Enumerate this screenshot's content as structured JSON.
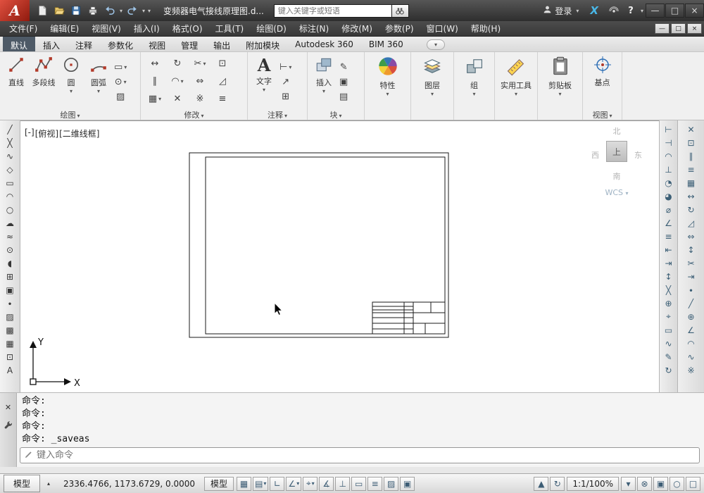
{
  "colors": {
    "titlebar": "#3a3a3a",
    "logo_red": "#a82114",
    "active_tab": "#4e5a67",
    "exchange_blue": "#49b8e8"
  },
  "titlebar": {
    "logo_letter": "A",
    "doc_title": "变频器电气接线原理图.d...",
    "search_placeholder": "键入关键字或短语",
    "login": "登录",
    "help": "?",
    "min": "—",
    "max": "□",
    "close": "×"
  },
  "menus": {
    "items": [
      {
        "name": "menu-file",
        "label": "文件(F)"
      },
      {
        "name": "menu-edit",
        "label": "编辑(E)"
      },
      {
        "name": "menu-view",
        "label": "视图(V)"
      },
      {
        "name": "menu-insert",
        "label": "插入(I)"
      },
      {
        "name": "menu-format",
        "label": "格式(O)"
      },
      {
        "name": "menu-tools",
        "label": "工具(T)"
      },
      {
        "name": "menu-draw",
        "label": "绘图(D)"
      },
      {
        "name": "menu-dimension",
        "label": "标注(N)"
      },
      {
        "name": "menu-modify",
        "label": "修改(M)"
      },
      {
        "name": "menu-parametric",
        "label": "参数(P)"
      },
      {
        "name": "menu-window",
        "label": "窗口(W)"
      },
      {
        "name": "menu-help",
        "label": "帮助(H)"
      }
    ]
  },
  "docwin": {
    "min": "—",
    "restore": "□",
    "close": "×"
  },
  "ribbon_tabs": {
    "items": [
      {
        "name": "tab-home",
        "label": "默认",
        "active": true
      },
      {
        "name": "tab-insert",
        "label": "插入"
      },
      {
        "name": "tab-annotate",
        "label": "注释"
      },
      {
        "name": "tab-parametric",
        "label": "参数化"
      },
      {
        "name": "tab-view",
        "label": "视图"
      },
      {
        "name": "tab-manage",
        "label": "管理"
      },
      {
        "name": "tab-output",
        "label": "输出"
      },
      {
        "name": "tab-addins",
        "label": "附加模块"
      },
      {
        "name": "tab-a360",
        "label": "Autodesk 360"
      },
      {
        "name": "tab-bim360",
        "label": "BIM 360"
      }
    ]
  },
  "panels": {
    "draw": {
      "title": "绘图",
      "line": "直线",
      "polyline": "多段线",
      "circle": "圆",
      "arc": "圆弧",
      "small": [
        {
          "name": "rectangle-icon",
          "glyph": "▭",
          "caret": true
        },
        {
          "name": "ellipse-icon",
          "glyph": "⊙",
          "caret": true
        },
        {
          "name": "hatch-icon",
          "glyph": "▨"
        }
      ]
    },
    "modify": {
      "title": "修改",
      "icons": [
        {
          "name": "move-icon",
          "glyph": "↔"
        },
        {
          "name": "rotate-icon",
          "glyph": "↻"
        },
        {
          "name": "trim-icon",
          "glyph": "✂",
          "caret": true
        },
        {
          "name": "copy-icon",
          "glyph": "⊡"
        },
        {
          "name": "mirror-icon",
          "glyph": "∥"
        },
        {
          "name": "fillet-icon",
          "glyph": "◠",
          "caret": true
        },
        {
          "name": "stretch-icon",
          "glyph": "⇔"
        },
        {
          "name": "scale-icon",
          "glyph": "◿"
        },
        {
          "name": "array-icon",
          "glyph": "▦",
          "caret": true
        },
        {
          "name": "erase-icon",
          "glyph": "✕"
        },
        {
          "name": "explode-icon",
          "glyph": "※"
        },
        {
          "name": "offset-icon",
          "glyph": "≡"
        }
      ]
    },
    "annotate": {
      "title": "注释",
      "text": "文字",
      "icon": "A",
      "small": [
        {
          "name": "linear-dimension-icon",
          "glyph": "⊢",
          "caret": true
        },
        {
          "name": "leader-icon",
          "glyph": "↗"
        },
        {
          "name": "table-icon",
          "glyph": "⊞"
        }
      ]
    },
    "block": {
      "title": "块",
      "insert": "插入",
      "small": [
        {
          "name": "edit-block-icon",
          "glyph": "✎"
        },
        {
          "name": "create-block-icon",
          "glyph": "▣"
        },
        {
          "name": "block-attributes-icon",
          "glyph": "▤"
        }
      ]
    },
    "properties": {
      "title": "特性"
    },
    "layers": {
      "title": "图层"
    },
    "groups": {
      "title": "组"
    },
    "utilities": {
      "title": "实用工具"
    },
    "clipboard": {
      "title": "剪贴板"
    },
    "view": {
      "title": "视图",
      "basepoint": "基点"
    }
  },
  "canvas": {
    "viewport_menu": "[-]",
    "viewport_view": "[俯视]",
    "viewport_visual": "[二维线框]",
    "viewcube": {
      "n": "北",
      "s": "南",
      "w": "西",
      "e": "东",
      "top": "上",
      "wcs": "WCS"
    },
    "ucs_x": "X",
    "ucs_y": "Y"
  },
  "command": {
    "history": [
      "命令:",
      "命令:",
      "命令:",
      "命令: _saveas"
    ],
    "placeholder": "键入命令"
  },
  "statusbar": {
    "model_tab": "模型",
    "coords": "2336.4766, 1173.6729, 0.0000",
    "model_button": "模型",
    "scale": "1:1/100%",
    "icons_left": [
      {
        "name": "grid-display-icon",
        "glyph": "▦"
      },
      {
        "name": "snap-mode-icon",
        "glyph": "▤",
        "caret": true
      },
      {
        "name": "ortho-mode-icon",
        "glyph": "∟"
      },
      {
        "name": "polar-tracking-icon",
        "glyph": "∠",
        "caret": true
      },
      {
        "name": "object-snap-icon",
        "glyph": "⌖",
        "caret": true
      },
      {
        "name": "object-snap-tracking-icon",
        "glyph": "∡"
      },
      {
        "name": "dynamic-ucs-icon",
        "glyph": "⊥"
      },
      {
        "name": "dynamic-input-icon",
        "glyph": "▭"
      },
      {
        "name": "lineweight-icon",
        "glyph": "≡"
      },
      {
        "name": "transparency-icon",
        "glyph": "▨"
      },
      {
        "name": "quick-properties-icon",
        "glyph": "▣"
      }
    ],
    "icons_right_a": [
      {
        "name": "annotation-visibility-icon",
        "glyph": "▲"
      },
      {
        "name": "annotation-autoscale-icon",
        "glyph": "↻"
      }
    ],
    "icons_right_b": [
      {
        "name": "annotation-scale-caret-icon",
        "glyph": "▾"
      },
      {
        "name": "workspace-switching-icon",
        "glyph": "⊗"
      },
      {
        "name": "display-lock-icon",
        "glyph": "▣"
      },
      {
        "name": "isolate-objects-icon",
        "glyph": "○"
      },
      {
        "name": "clean-screen-icon",
        "glyph": "□"
      }
    ]
  },
  "toolbars": {
    "left": [
      {
        "name": "line-icon",
        "glyph": "╱"
      },
      {
        "name": "construction-line-icon",
        "glyph": "╳"
      },
      {
        "name": "polyline-icon",
        "glyph": "∿"
      },
      {
        "name": "polygon-icon",
        "glyph": "◇"
      },
      {
        "name": "rectangle-icon",
        "glyph": "▭"
      },
      {
        "name": "arc-icon",
        "glyph": "◠"
      },
      {
        "name": "circle-icon",
        "glyph": "○"
      },
      {
        "name": "revision-cloud-icon",
        "glyph": "☁"
      },
      {
        "name": "spline-icon",
        "glyph": "≈"
      },
      {
        "name": "ellipse-icon",
        "glyph": "⊙"
      },
      {
        "name": "ellipse-arc-icon",
        "glyph": "◖"
      },
      {
        "name": "insert-block-icon",
        "glyph": "⊞"
      },
      {
        "name": "create-block-icon",
        "glyph": "▣"
      },
      {
        "name": "point-icon",
        "glyph": "∙"
      },
      {
        "name": "hatch-icon",
        "glyph": "▨"
      },
      {
        "name": "gradient-icon",
        "glyph": "▩"
      },
      {
        "name": "region-icon",
        "glyph": "▦"
      },
      {
        "name": "table-icon",
        "glyph": "⊡"
      },
      {
        "name": "mtext-icon",
        "glyph": "A"
      }
    ],
    "right_dim": [
      {
        "name": "dim-linear-icon",
        "glyph": "⊢"
      },
      {
        "name": "dim-aligned-icon",
        "glyph": "⊣"
      },
      {
        "name": "dim-arc-length-icon",
        "glyph": "◠"
      },
      {
        "name": "dim-ordinate-icon",
        "glyph": "⊥"
      },
      {
        "name": "dim-radius-icon",
        "glyph": "◔"
      },
      {
        "name": "dim-jogged-icon",
        "glyph": "◕"
      },
      {
        "name": "dim-diameter-icon",
        "glyph": "⌀"
      },
      {
        "name": "dim-angular-icon",
        "glyph": "∠"
      },
      {
        "name": "quick-dimension-icon",
        "glyph": "≡"
      },
      {
        "name": "dim-baseline-icon",
        "glyph": "⇤"
      },
      {
        "name": "dim-continue-icon",
        "glyph": "⇥"
      },
      {
        "name": "dim-space-icon",
        "glyph": "↕"
      },
      {
        "name": "dim-break-icon",
        "glyph": "╳"
      },
      {
        "name": "tolerance-icon",
        "glyph": "⊕"
      },
      {
        "name": "center-mark-icon",
        "glyph": "⌖"
      },
      {
        "name": "inspection-icon",
        "glyph": "▭"
      },
      {
        "name": "jogged-linear-icon",
        "glyph": "∿"
      },
      {
        "name": "dim-edit-icon",
        "glyph": "✎"
      },
      {
        "name": "dim-update-icon",
        "glyph": "↻"
      }
    ],
    "right_modify": [
      {
        "name": "erase-icon",
        "glyph": "✕"
      },
      {
        "name": "copy-icon",
        "glyph": "⊡"
      },
      {
        "name": "mirror-icon",
        "glyph": "∥"
      },
      {
        "name": "offset-icon",
        "glyph": "≡"
      },
      {
        "name": "array-icon",
        "glyph": "▦"
      },
      {
        "name": "move-icon",
        "glyph": "↔"
      },
      {
        "name": "rotate-icon",
        "glyph": "↻"
      },
      {
        "name": "scale-icon",
        "glyph": "◿"
      },
      {
        "name": "stretch-icon",
        "glyph": "⇔"
      },
      {
        "name": "lengthen-icon",
        "glyph": "↕"
      },
      {
        "name": "trim-icon",
        "glyph": "✂"
      },
      {
        "name": "extend-icon",
        "glyph": "⇥"
      },
      {
        "name": "break-at-point-icon",
        "glyph": "∙"
      },
      {
        "name": "break-icon",
        "glyph": "╱"
      },
      {
        "name": "join-icon",
        "glyph": "⊕"
      },
      {
        "name": "chamfer-icon",
        "glyph": "∠"
      },
      {
        "name": "fillet-icon",
        "glyph": "◠"
      },
      {
        "name": "blend-curves-icon",
        "glyph": "∿"
      },
      {
        "name": "explode-icon",
        "glyph": "※"
      }
    ]
  }
}
